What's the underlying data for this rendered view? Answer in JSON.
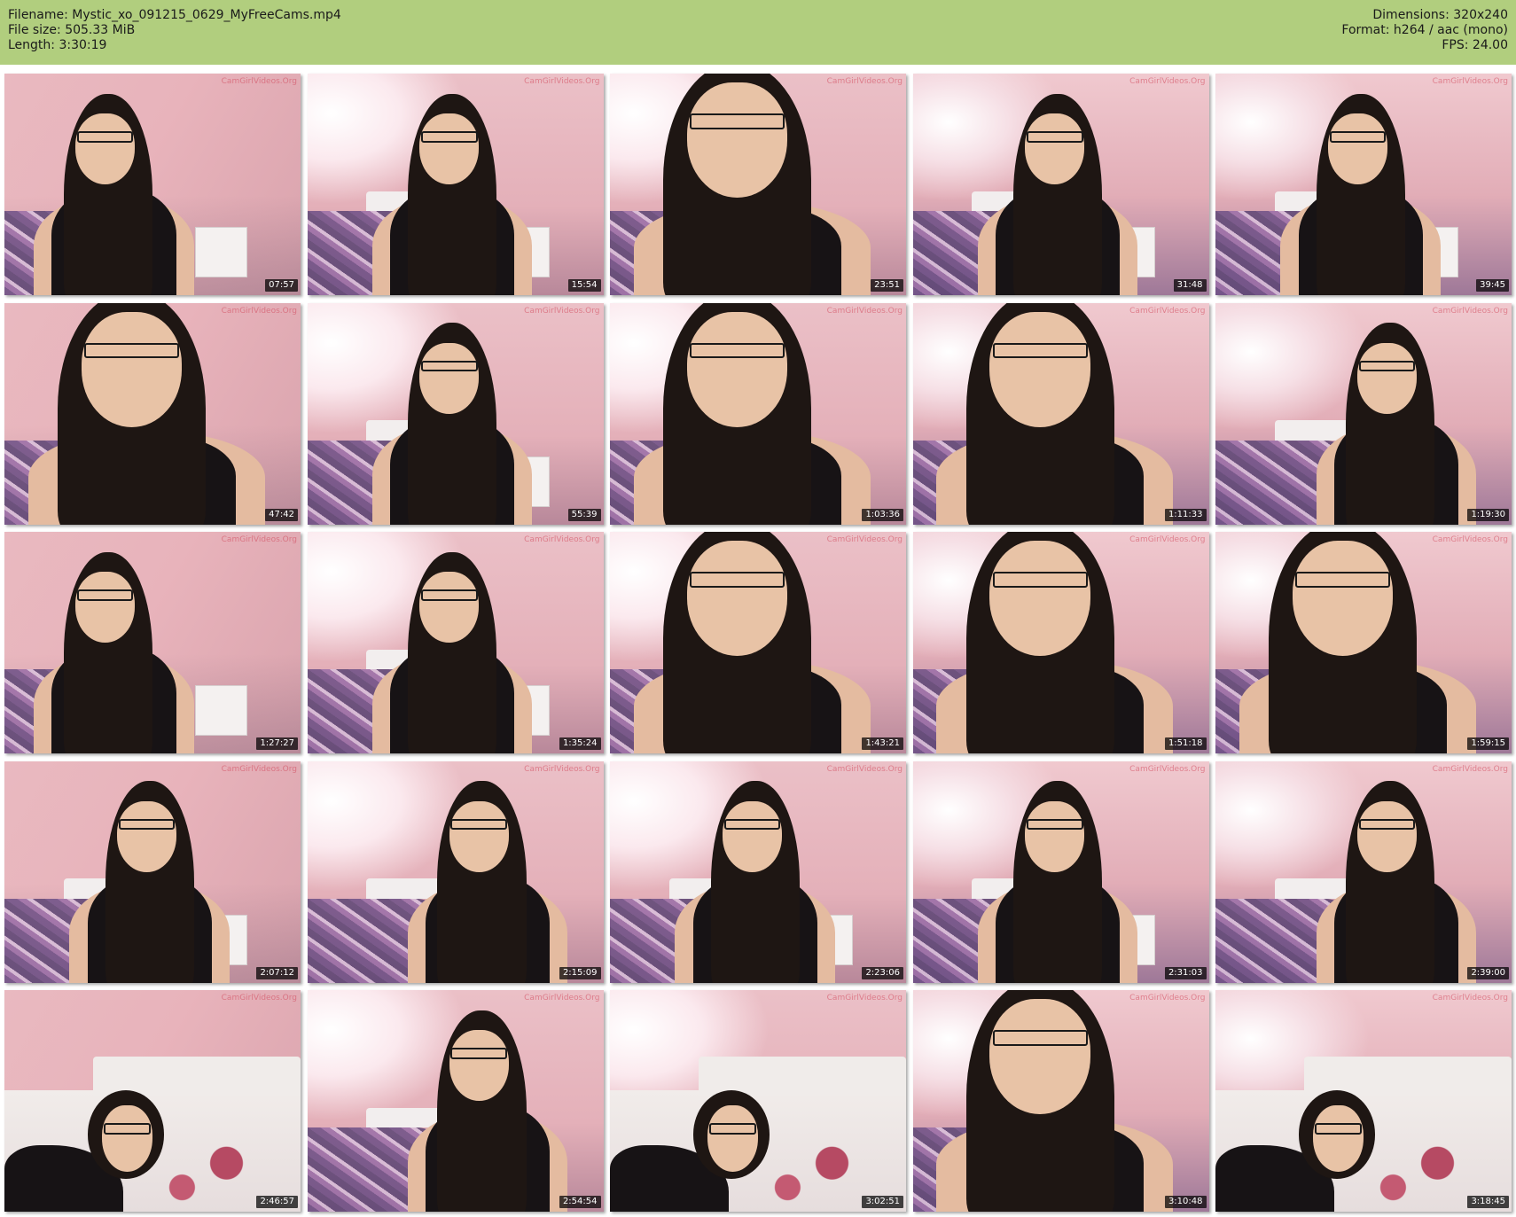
{
  "header": {
    "filename": "Filename: Mystic_xo_091215_0629_MyFreeCams.mp4",
    "filesize": "File size: 505.33 MiB",
    "length": "Length: 3:30:19",
    "dimensions": "Dimensions: 320x240",
    "format": "Format: h264 / aac (mono)",
    "fps": "FPS: 24.00"
  },
  "watermark": "CamGirlVideos.Org",
  "colors": {
    "header_bg": "#b1ce7e",
    "timestamp_bg": "#000000",
    "timestamp_text": "#ffffff"
  },
  "thumbnails": [
    {
      "ts": "07:57"
    },
    {
      "ts": "15:54"
    },
    {
      "ts": "23:51"
    },
    {
      "ts": "31:48"
    },
    {
      "ts": "39:45"
    },
    {
      "ts": "47:42"
    },
    {
      "ts": "55:39"
    },
    {
      "ts": "1:03:36"
    },
    {
      "ts": "1:11:33"
    },
    {
      "ts": "1:19:30"
    },
    {
      "ts": "1:27:27"
    },
    {
      "ts": "1:35:24"
    },
    {
      "ts": "1:43:21"
    },
    {
      "ts": "1:51:18"
    },
    {
      "ts": "1:59:15"
    },
    {
      "ts": "2:07:12"
    },
    {
      "ts": "2:15:09"
    },
    {
      "ts": "2:23:06"
    },
    {
      "ts": "2:31:03"
    },
    {
      "ts": "2:39:00"
    },
    {
      "ts": "2:46:57"
    },
    {
      "ts": "2:54:54"
    },
    {
      "ts": "3:02:51"
    },
    {
      "ts": "3:10:48"
    },
    {
      "ts": "3:18:45"
    }
  ]
}
